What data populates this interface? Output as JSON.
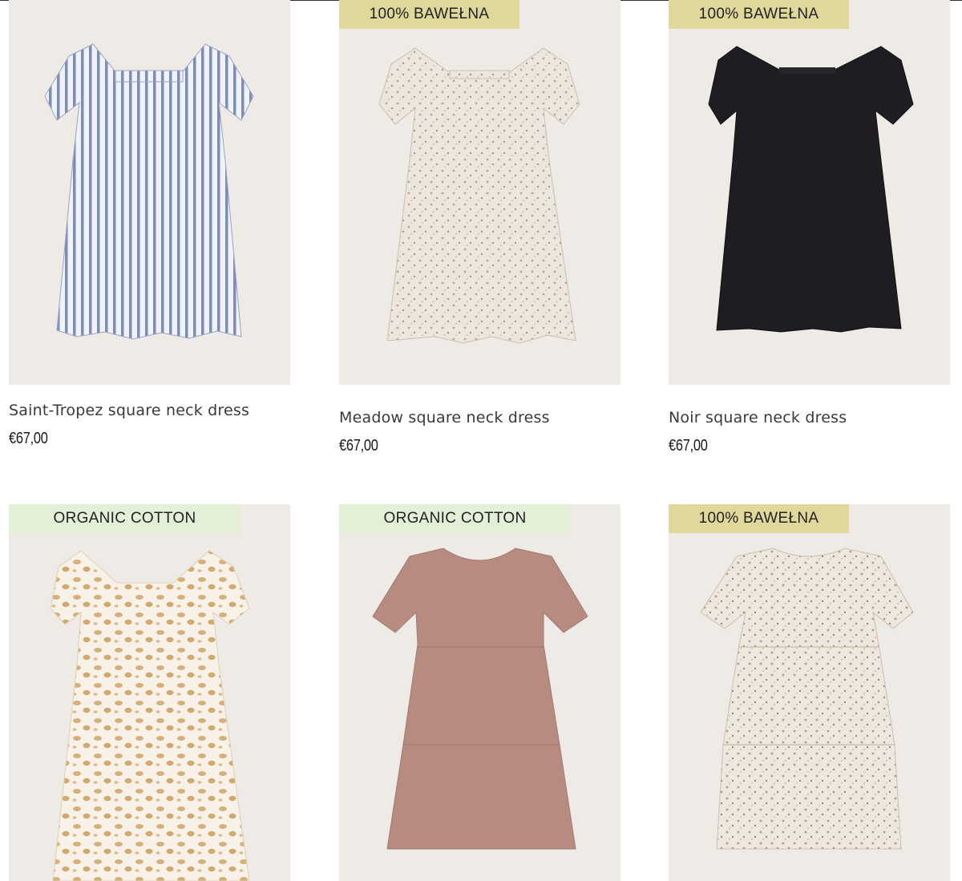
{
  "products": [
    {
      "title": "Saint-Tropez square neck dress",
      "price": "€67,00",
      "badge": ""
    },
    {
      "title": "Meadow square neck dress",
      "price": "€67,00",
      "badge": "100% BAWEŁNA"
    },
    {
      "title": "Noir square neck dress",
      "price": "€67,00",
      "badge": "100% BAWEŁNA"
    },
    {
      "title": "",
      "price": "",
      "badge": "ORGANIC COTTON"
    },
    {
      "title": "",
      "price": "",
      "badge": "ORGANIC COTTON"
    },
    {
      "title": "",
      "price": "",
      "badge": "100% BAWEŁNA"
    }
  ],
  "colors": {
    "card_bg": "#eeebe6",
    "badge_cotton": "#e0d89b",
    "badge_organic": "#e3efd6"
  }
}
